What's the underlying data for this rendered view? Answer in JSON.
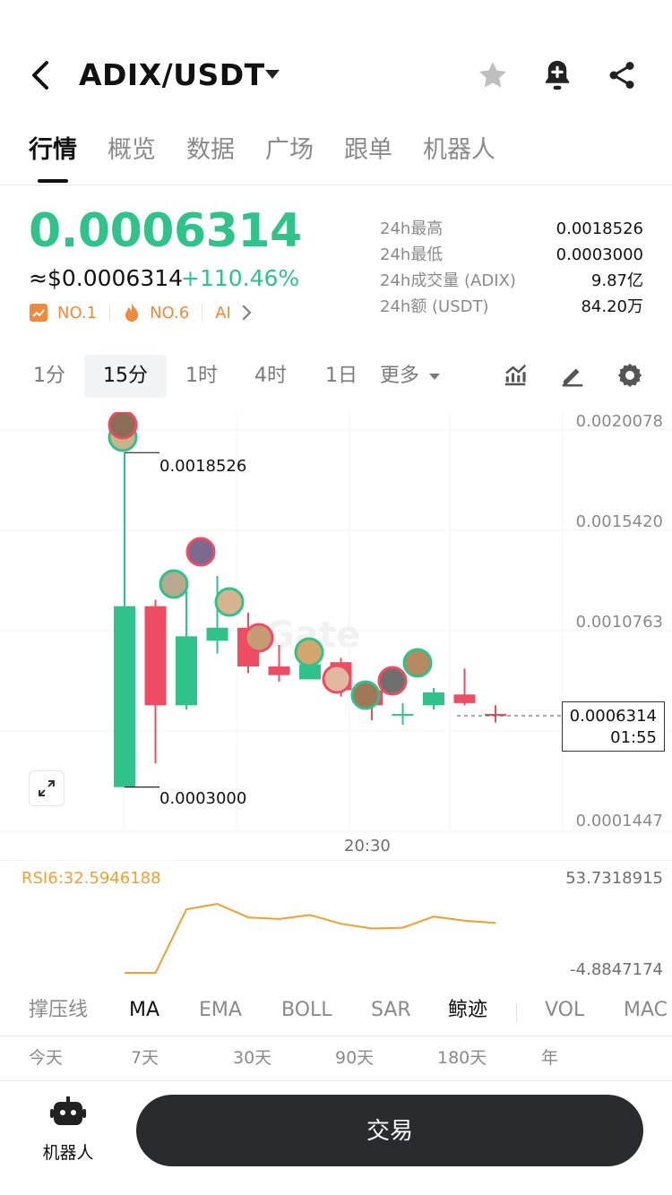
{
  "header": {
    "pair": "ADIX/USDT",
    "icons": [
      "back-arrow-icon",
      "star-icon",
      "bell-add-icon",
      "share-icon"
    ]
  },
  "main_tabs": [
    "行情",
    "概览",
    "数据",
    "广场",
    "跟单",
    "机器人"
  ],
  "price": {
    "last": "0.0006314",
    "usd": "≈$0.0006314",
    "change": "+110.46%",
    "badges": [
      "NO.1",
      "NO.6",
      "AI"
    ]
  },
  "stats": [
    {
      "label": "24h最高",
      "value": "0.0018526"
    },
    {
      "label": "24h最低",
      "value": "0.0003000"
    },
    {
      "label": "24h成交量 (ADIX)",
      "value": "9.87亿"
    },
    {
      "label": "24h额 (USDT)",
      "value": "84.20万"
    }
  ],
  "intervals": [
    "1分",
    "15分",
    "1时",
    "4时",
    "1日",
    "更多"
  ],
  "active_interval": "15分",
  "chart": {
    "y_labels": [
      "0.0020078",
      "0.0015420",
      "0.0010763",
      "0.0001447"
    ],
    "high_label": "0.0018526",
    "low_label": "0.0003000",
    "current_price": "0.0006314",
    "countdown": "01:55",
    "time_label": "20:30",
    "watermark": "Gate"
  },
  "chart_data": {
    "type": "candlestick",
    "ylim": [
      0.0001447,
      0.0020078
    ],
    "candles": [
      {
        "open": 0.0003,
        "high": 0.001853,
        "low": 0.0003,
        "close": 0.00114
      },
      {
        "open": 0.00114,
        "high": 0.00117,
        "low": 0.00041,
        "close": 0.00068
      },
      {
        "open": 0.00068,
        "high": 0.00121,
        "low": 0.00066,
        "close": 0.001
      },
      {
        "open": 0.00098,
        "high": 0.00128,
        "low": 0.00092,
        "close": 0.00104
      },
      {
        "open": 0.00104,
        "high": 0.00111,
        "low": 0.00083,
        "close": 0.00086
      },
      {
        "open": 0.00086,
        "high": 0.00096,
        "low": 0.00079,
        "close": 0.00082
      },
      {
        "open": 0.0008,
        "high": 0.00088,
        "low": 0.0008,
        "close": 0.00087
      },
      {
        "open": 0.00088,
        "high": 0.0009,
        "low": 0.00072,
        "close": 0.00075
      },
      {
        "open": 0.00075,
        "high": 0.00077,
        "low": 0.00061,
        "close": 0.00068
      },
      {
        "open": 0.00064,
        "high": 0.00069,
        "low": 0.00059,
        "close": 0.00064
      },
      {
        "open": 0.00068,
        "high": 0.00076,
        "low": 0.00066,
        "close": 0.00074
      },
      {
        "open": 0.00073,
        "high": 0.00085,
        "low": 0.00068,
        "close": 0.00069
      },
      {
        "open": 0.00064,
        "high": 0.00068,
        "low": 0.0006,
        "close": 0.000631
      }
    ],
    "rsi": {
      "label": "RSI6:32.5946188",
      "max": "53.7318915",
      "min": "-4.8847174",
      "ylim": [
        -4.8847174,
        53.7318915
      ],
      "values": [
        -4.88,
        -4.88,
        35.0,
        38.5,
        30.0,
        29.0,
        31.5,
        26.0,
        23.0,
        23.5,
        30.5,
        28.0,
        26.5
      ]
    }
  },
  "indicators": [
    "撑压线",
    "MA",
    "EMA",
    "BOLL",
    "SAR",
    "鲸迹",
    "VOL",
    "MAC"
  ],
  "active_indicators": [
    "MA",
    "鲸迹"
  ],
  "periods": [
    "今天",
    "7天",
    "30天",
    "90天",
    "180天",
    "年"
  ],
  "bottom": {
    "robot_label": "机器人",
    "trade_label": "交易"
  },
  "colors": {
    "up": "#2fc28a",
    "down": "#ee4c62",
    "rsi": "#f0a030",
    "badge": "#f0893d"
  }
}
